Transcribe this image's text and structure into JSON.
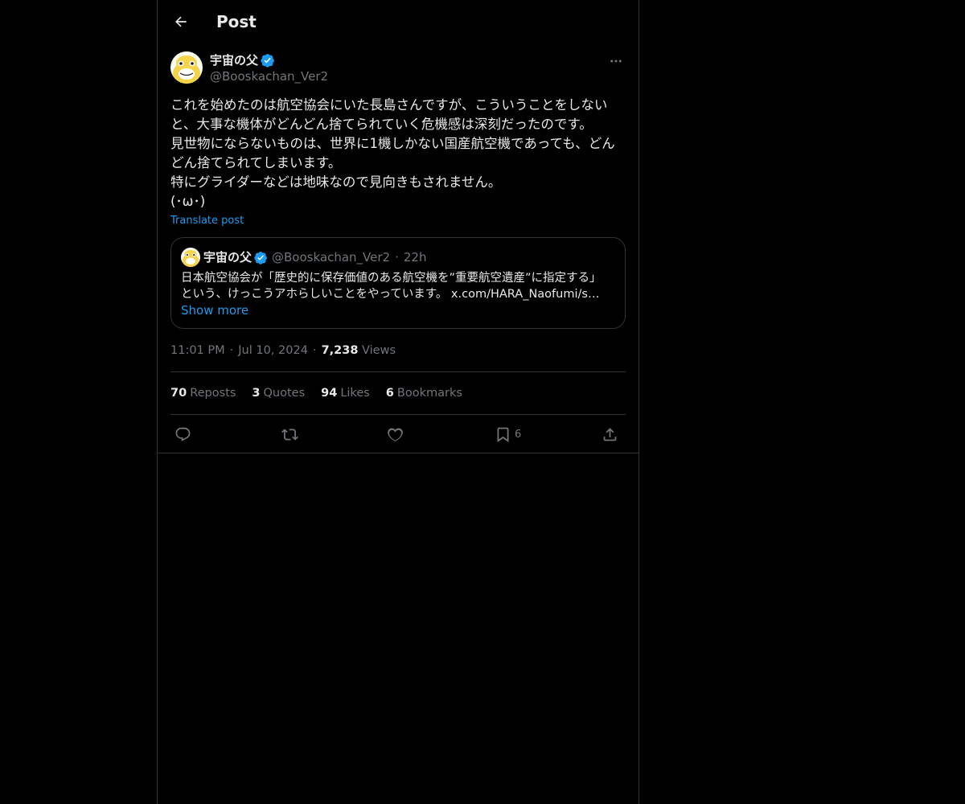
{
  "header": {
    "title": "Post"
  },
  "post": {
    "author": {
      "name": "宇宙の父",
      "handle": "@Booskachan_Ver2",
      "verified": true
    },
    "text": "これを始めたのは航空協会にいた長島さんですが、こういうことをしないと、大事な機体がどんどん捨てられていく危機感は深刻だったのです。\n見世物にならないものは、世界に1機しかない国産航空機であっても、どんどん捨てられてしまいます。\n特にグライダーなどは地味なので見向きもされません。\n(･ω･)",
    "translate_label": "Translate post",
    "quote": {
      "name": "宇宙の父",
      "handle": "@Booskachan_Ver2",
      "separator": "·",
      "time": "22h",
      "line1": "日本航空協会が「歴史的に保存価値のある航空機を”重要航空遺産”に指定する」",
      "line2": "という、けっこうアホらしいことをやっています。 x.com/HARA_Naofumi/s…",
      "show_more": "Show more"
    },
    "meta": {
      "time": "11:01 PM",
      "date": "Jul 10, 2024",
      "views_count": "7,238",
      "views_label": "Views",
      "separator": "·"
    },
    "stats": [
      {
        "count": "70",
        "label": "Reposts"
      },
      {
        "count": "3",
        "label": "Quotes"
      },
      {
        "count": "94",
        "label": "Likes"
      },
      {
        "count": "6",
        "label": "Bookmarks"
      }
    ],
    "actions": {
      "reply": "reply-icon",
      "repost": "repost-icon",
      "like": "heart-icon",
      "bookmark": "bookmark-icon",
      "bookmark_count": "6",
      "share": "share-icon"
    }
  },
  "colors": {
    "background": "#000000",
    "text": "#e7e9ea",
    "muted": "#71767b",
    "accent": "#1d9bf0",
    "border": "#2f3336",
    "verified": "#1d9bf0"
  }
}
